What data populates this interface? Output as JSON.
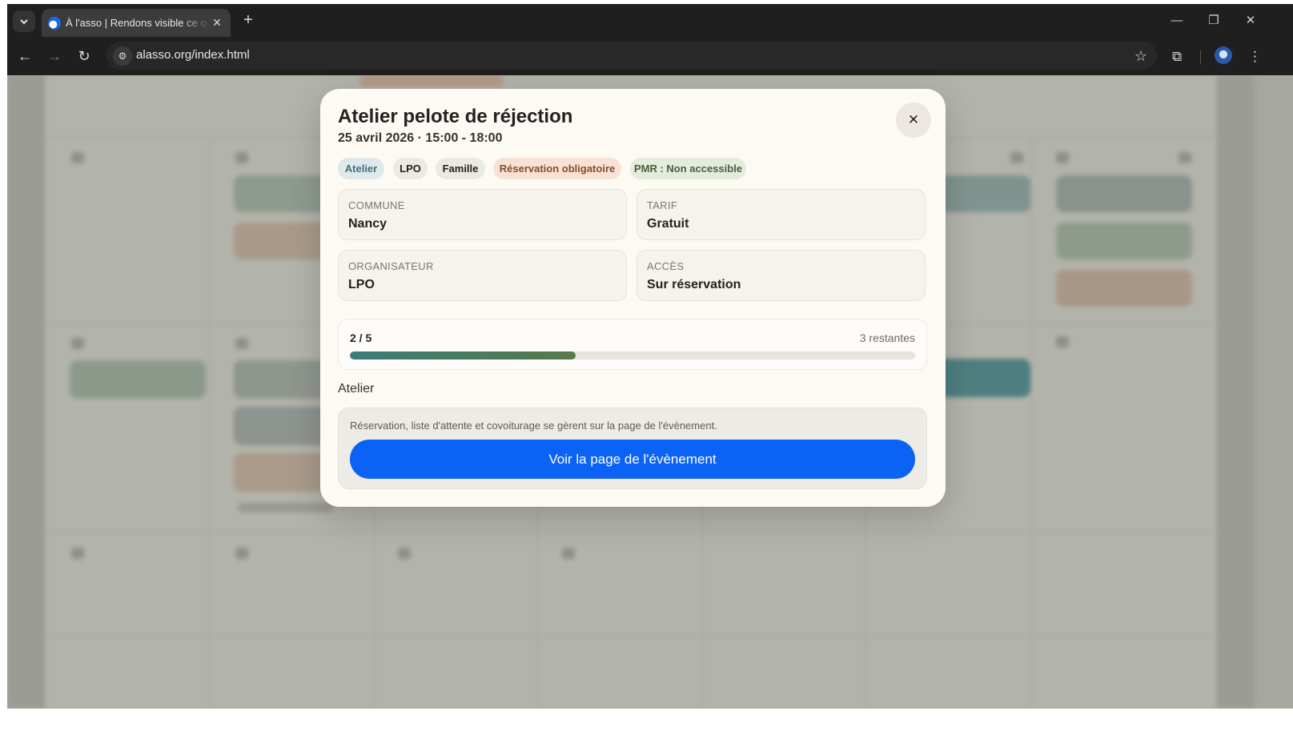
{
  "browser": {
    "tab_title": "À l'asso | Rendons visible ce qui",
    "url": "alasso.org/index.html"
  },
  "event": {
    "title": "Atelier pelote de réjection",
    "datetime": "25 avril 2026 · 15:00 - 18:00",
    "tags": [
      {
        "label": "Atelier",
        "bg": "#dfe9eb",
        "color": "#3c6f78"
      },
      {
        "label": "LPO",
        "bg": "#ece8e2",
        "color": "#222222"
      },
      {
        "label": "Famille",
        "bg": "#ece8e2",
        "color": "#222222"
      },
      {
        "label": "Réservation obligatoire",
        "bg": "#f7e3d6",
        "color": "#8a4a22"
      },
      {
        "label": "PMR : Non accessible",
        "bg": "#e4ecdc",
        "color": "#4a5f3c"
      }
    ],
    "details": {
      "commune": {
        "label": "COMMUNE",
        "value": "Nancy"
      },
      "tarif": {
        "label": "TARIF",
        "value": "Gratuit"
      },
      "organisateur": {
        "label": "ORGANISATEUR",
        "value": "LPO"
      },
      "acces": {
        "label": "ACCÈS",
        "value": "Sur réservation"
      }
    },
    "capacity": {
      "count_text": "2 / 5",
      "remaining_text": "3 restantes",
      "fill_fraction": 0.4
    },
    "category": "Atelier",
    "cta": {
      "note": "Réservation, liste d'attente et covoiturage se gèrent sur la page de l'évènement.",
      "button_label": "Voir la page de l'évènement"
    }
  }
}
